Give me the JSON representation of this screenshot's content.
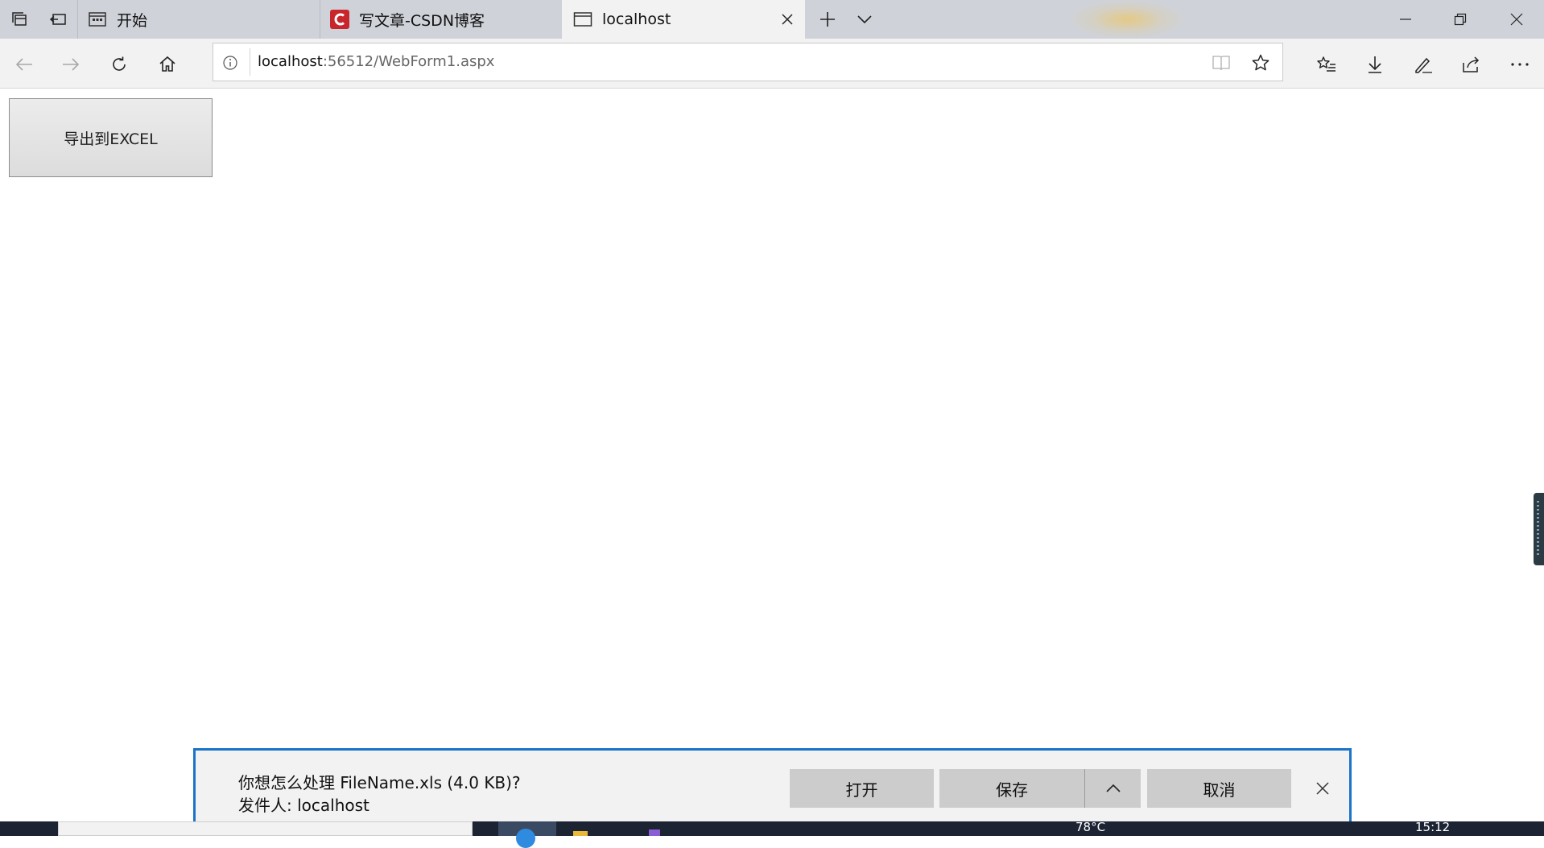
{
  "tabs": [
    {
      "label": "开始",
      "icon": "start-page-icon"
    },
    {
      "label": "写文章-CSDN博客",
      "icon": "csdn-logo-icon",
      "brand_color": "#c9252c"
    },
    {
      "label": "localhost",
      "icon": "page-icon",
      "active": true
    }
  ],
  "address_bar": {
    "host": "localhost",
    "path": ":56512/WebForm1.aspx"
  },
  "page": {
    "export_button_label": "导出到EXCEL"
  },
  "download_bar": {
    "question": "你想怎么处理 FileName.xls (4.0 KB)?",
    "from": "发件人: localhost",
    "open_label": "打开",
    "save_label": "保存",
    "cancel_label": "取消",
    "accent_color": "#1a74c7"
  },
  "taskbar": {
    "temperature": "78°C",
    "time": "15:12"
  }
}
